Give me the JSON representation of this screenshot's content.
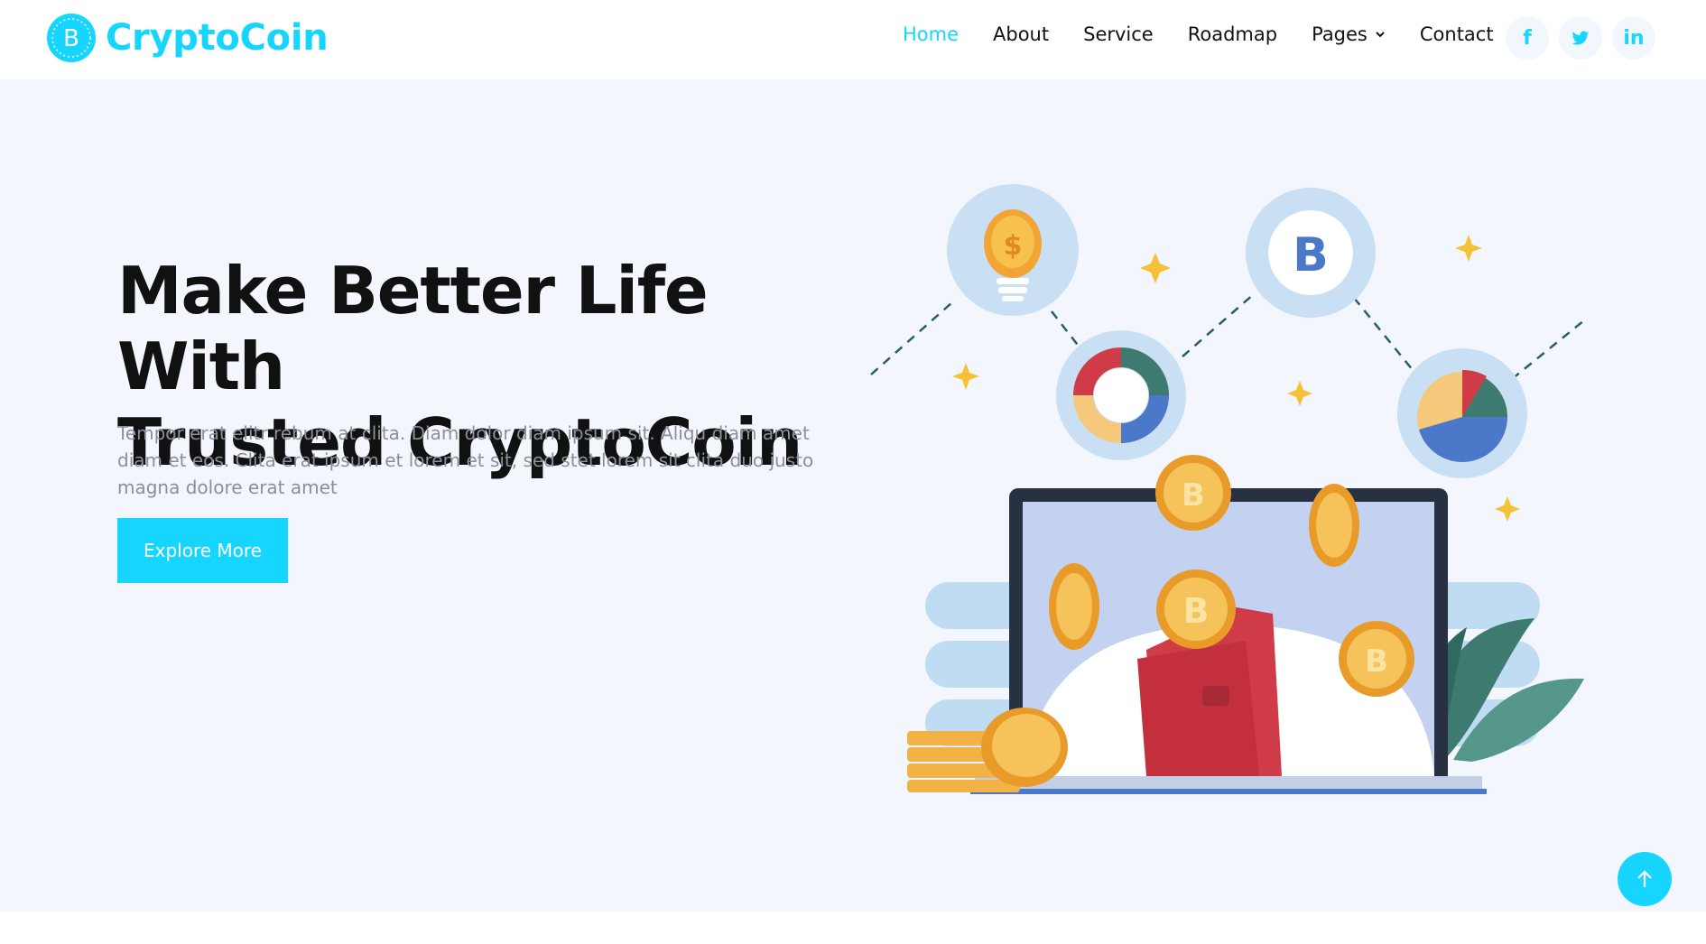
{
  "brand": {
    "name": "CryptoCoin",
    "logo_icon": "bitcoin-icon",
    "accent": "#16d5ff"
  },
  "nav": {
    "items": [
      {
        "label": "Home",
        "active": true
      },
      {
        "label": "About"
      },
      {
        "label": "Service"
      },
      {
        "label": "Roadmap"
      },
      {
        "label": "Pages",
        "dropdown": true
      },
      {
        "label": "Contact"
      }
    ]
  },
  "socials": [
    {
      "icon": "facebook-icon",
      "glyph": "f"
    },
    {
      "icon": "twitter-icon",
      "glyph": "t"
    },
    {
      "icon": "linkedin-icon",
      "glyph": "in"
    }
  ],
  "hero": {
    "title_line1": "Make Better Life With",
    "title_line2": "Trusted CryptoCoin",
    "description": "Tempor erat elitr rebum at clita. Diam dolor diam ipsum sit. Aliqu diam amet diam et eos. Clita erat ipsum et lorem et sit, sed stet lorem sit clita duo justo magna dolore erat amet",
    "cta_label": "Explore More",
    "background": "#f3f7fd"
  },
  "colors": {
    "accent": "#16d5ff",
    "text": "#111111",
    "muted": "#8a8f99"
  }
}
